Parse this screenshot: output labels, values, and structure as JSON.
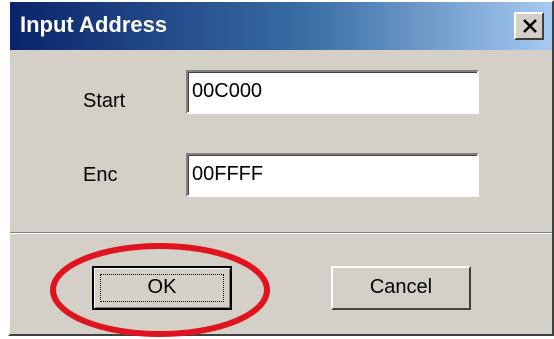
{
  "window": {
    "title": "Input Address"
  },
  "form": {
    "start_label": "Start",
    "start_value": "00C000",
    "end_label": "Enc",
    "end_value": "00FFFF"
  },
  "buttons": {
    "ok_label": "OK",
    "cancel_label": "Cancel"
  },
  "annotation": {
    "highlight_color": "#e0141e",
    "highlight_target": "ok-button"
  },
  "icons": {
    "close": "close-icon"
  }
}
